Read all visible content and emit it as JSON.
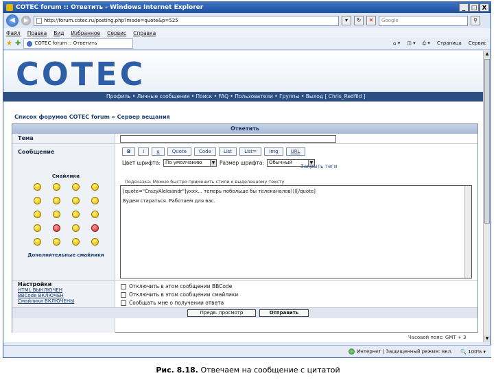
{
  "window": {
    "title": "COTEC forum :: Ответить - Windows Internet Explorer",
    "controls": [
      "_",
      "□",
      "X"
    ]
  },
  "address": {
    "url": "http://forum.cotec.ru/posting.php?mode=quote&p=525",
    "search_placeholder": "Google"
  },
  "menu": [
    "Файл",
    "Правка",
    "Вид",
    "Избранное",
    "Сервис",
    "Справка"
  ],
  "tab": {
    "label": "COTEC forum :: Ответить"
  },
  "toolbar": {
    "page": "Страница",
    "tools": "Сервис"
  },
  "page": {
    "logo": "COTEC",
    "nav": "Профиль • Личные сообщения • Поиск • FAQ • Пользователи • Группы • Выход [ Chris_Redfild ]",
    "breadcrumb": "Список форумов COTEC forum » Сервер вещания",
    "form_title": "Ответить",
    "topic_label": "Тема",
    "message_label": "Сообщение",
    "smilies_title": "Смайлики",
    "more_smilies": "Дополнительные смайлики",
    "bbcode_buttons": [
      "B",
      "i",
      "u",
      "Quote",
      "Code",
      "List",
      "List=",
      "Img",
      "URL"
    ],
    "font_color_label": "Цвет шрифта:",
    "font_color_value": "По умолчанию",
    "font_size_label": "Размер шрифта:",
    "font_size_value": "Обычный",
    "close_tags": "Закрыть теги",
    "hint": "Подсказка: Можно быстро применить стили к выделенному тексту",
    "message_line1": "[quote=\"CrazyAleksandr\"]уххх... теперь побольше бы телеканалов)))[/quote]",
    "message_line2": "Будем стараться. Работаем для вас.",
    "settings_title": "Настройки",
    "settings_html": "HTML ВЫКЛЮЧЕН",
    "settings_bbcode": "BBCode ВКЛЮЧЕН",
    "settings_smilies": "Смайлики ВКЛЮЧЕНЫ",
    "opt1": "Отключить в этом сообщении BBCode",
    "opt2": "Отключить в этом сообщении смайлики",
    "opt3": "Сообщать мне о получении ответа",
    "preview_btn": "Предв. просмотр",
    "submit_btn": "Отправить",
    "gmt": "Часовой пояс: GMT + 3"
  },
  "status": {
    "zone": "Интернет | Защищенный режим: вкл.",
    "zoom": "100%"
  },
  "caption": {
    "label": "Рис. 8.18.",
    "text": "Отвечаем на сообщение с цитатой"
  }
}
